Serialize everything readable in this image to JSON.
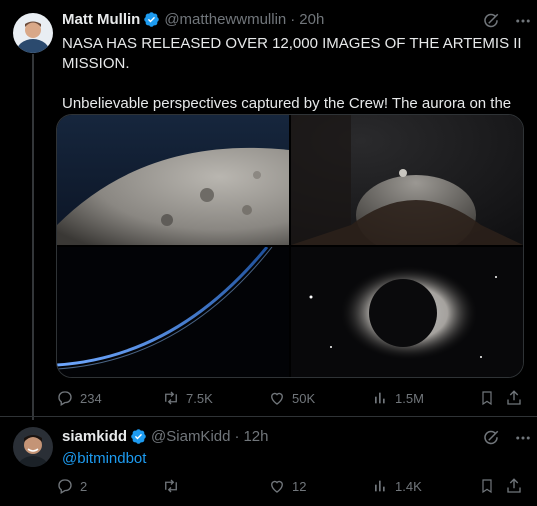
{
  "tweet1": {
    "author_name": "Matt Mullin",
    "handle": "@matthewwmullin",
    "separator": "·",
    "time": "20h",
    "text_line1": "NASA HAS RELEASED OVER 12,000 IMAGES OF THE ARTEMIS II MISSION.",
    "text_line2": "Unbelievable perspectives captured by the Crew! The aurora on the eclipse is incredible.",
    "stats": {
      "replies": "234",
      "reposts": "7.5K",
      "likes": "50K",
      "views": "1.5M"
    }
  },
  "tweet2": {
    "author_name": "siamkidd",
    "handle": "@SiamKidd",
    "separator": "·",
    "time": "12h",
    "text": "@bitmindbot",
    "stats": {
      "replies": "2",
      "reposts": "",
      "likes": "12",
      "views": "1.4K"
    }
  },
  "colors": {
    "background": "#000000",
    "text": "#e7e9ea",
    "muted": "#71767b",
    "accent": "#1d9bf0",
    "border": "#2f3336"
  },
  "icons": [
    "verified-icon",
    "grok-icon",
    "more-icon",
    "reply-icon",
    "repost-icon",
    "like-icon",
    "views-icon",
    "bookmark-icon",
    "share-icon"
  ]
}
